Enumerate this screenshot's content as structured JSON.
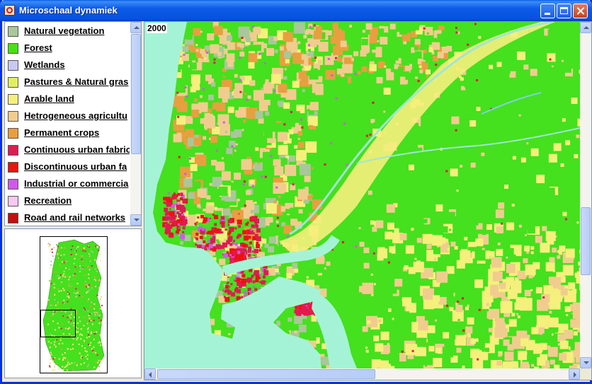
{
  "window": {
    "title": "Microschaal dynamiek"
  },
  "legend": {
    "items": [
      {
        "label": "Natural vegetation",
        "color": "#a9c79a"
      },
      {
        "label": "Forest",
        "color": "#45e01e"
      },
      {
        "label": "Wetlands",
        "color": "#c8c8f2"
      },
      {
        "label": "Pastures & Natural gras",
        "color": "#e2ee61"
      },
      {
        "label": "Arable land",
        "color": "#f5f07c"
      },
      {
        "label": "Hetrogeneous agricultu",
        "color": "#f0cd8e"
      },
      {
        "label": "Permanent crops",
        "color": "#e89f40"
      },
      {
        "label": "Continuous urban fabric",
        "color": "#e11a52"
      },
      {
        "label": "Discontinuous urban fa",
        "color": "#f01010"
      },
      {
        "label": "Industrial or commercia",
        "color": "#cf5ae8"
      },
      {
        "label": "Recreation",
        "color": "#fac8f0"
      },
      {
        "label": "Road and rail networks",
        "color": "#c01010"
      }
    ]
  },
  "map": {
    "year": "2000",
    "water_color": "#a5f3d6",
    "colors": {
      "forest": "#45e01e",
      "arable": "#f5f07c",
      "hetero": "#f0cd8e",
      "permanent": "#e89f40",
      "natural": "#a9c79a",
      "pasture": "#e2ee61",
      "urban": "#e11a52",
      "discontinuous": "#f01010",
      "industrial": "#cf5ae8",
      "wetlands": "#c8c8f2",
      "recreation": "#fac8f0"
    }
  },
  "icons": {
    "app": "app-icon",
    "minimize": "minimize-icon",
    "maximize": "maximize-icon",
    "close": "close-icon"
  }
}
